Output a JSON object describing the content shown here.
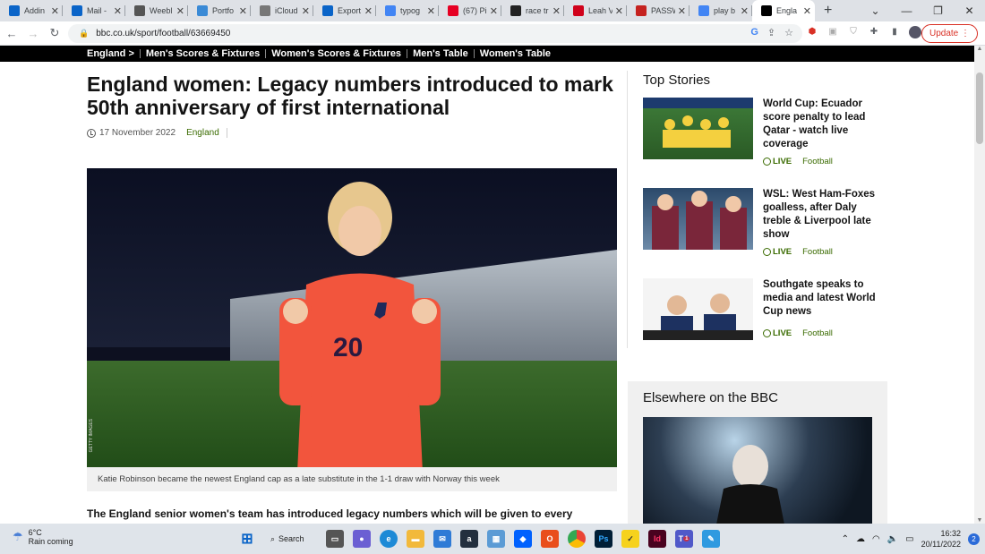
{
  "browser": {
    "tabs": [
      {
        "title": "Addin",
        "icon": "outlook-icon",
        "color": "#0a64c8"
      },
      {
        "title": "Mail -",
        "icon": "outlook-mail-icon",
        "color": "#0a64c8"
      },
      {
        "title": "Weebl",
        "icon": "globe-icon",
        "color": "#555555"
      },
      {
        "title": "Portfo",
        "icon": "cloud-icon",
        "color": "#3a8ad6"
      },
      {
        "title": "iCloud",
        "icon": "apple-icon",
        "color": "#777777"
      },
      {
        "title": "Export",
        "icon": "outlook-icon",
        "color": "#0a64c8"
      },
      {
        "title": "typog",
        "icon": "google-icon",
        "color": "#4285f4"
      },
      {
        "title": "(67) Pi",
        "icon": "pinterest-icon",
        "color": "#e60023"
      },
      {
        "title": "race tr",
        "icon": "bookmark-icon",
        "color": "#222222"
      },
      {
        "title": "Leah V",
        "icon": "arsenal-icon",
        "color": "#d0021b"
      },
      {
        "title": "PASSW",
        "icon": "gmail-icon",
        "color": "#c5221f"
      },
      {
        "title": "play b",
        "icon": "google-icon",
        "color": "#4285f4"
      },
      {
        "title": "Engla",
        "icon": "bbc-icon",
        "color": "#000000"
      }
    ],
    "url": "bbc.co.uk/sport/football/63669450",
    "update_label": "Update"
  },
  "subnav": [
    "England >",
    "Men's Scores & Fixtures",
    "Women's Scores & Fixtures",
    "Men's Table",
    "Women's Table"
  ],
  "article": {
    "headline": "England women: Legacy numbers introduced to mark 50th anniversary of first international",
    "date": "17 November 2022",
    "tag": "England",
    "image_credit": "GETTY IMAGES",
    "shirt_number": "20",
    "caption": "Katie Robinson became the newest England cap as a late substitute in the 1-1 draw with Norway this week",
    "lede": "The England senior women's team has introduced legacy numbers which will be given to every"
  },
  "top_stories": {
    "title": "Top Stories",
    "live_label": "LIVE",
    "items": [
      {
        "title": "World Cup: Ecuador score penalty to lead Qatar - watch live coverage",
        "section": "Football"
      },
      {
        "title": "WSL: West Ham-Foxes goalless, after Daly treble & Liverpool late show",
        "section": "Football"
      },
      {
        "title": "Southgate speaks to media and latest World Cup news",
        "section": "Football"
      }
    ]
  },
  "elsewhere": {
    "title": "Elsewhere on the BBC"
  },
  "taskbar": {
    "temp": "6°C",
    "weather": "Rain coming",
    "search": "Search",
    "time": "16:32",
    "date": "20/11/2022",
    "notifications": "2",
    "teams_badge": "1"
  }
}
